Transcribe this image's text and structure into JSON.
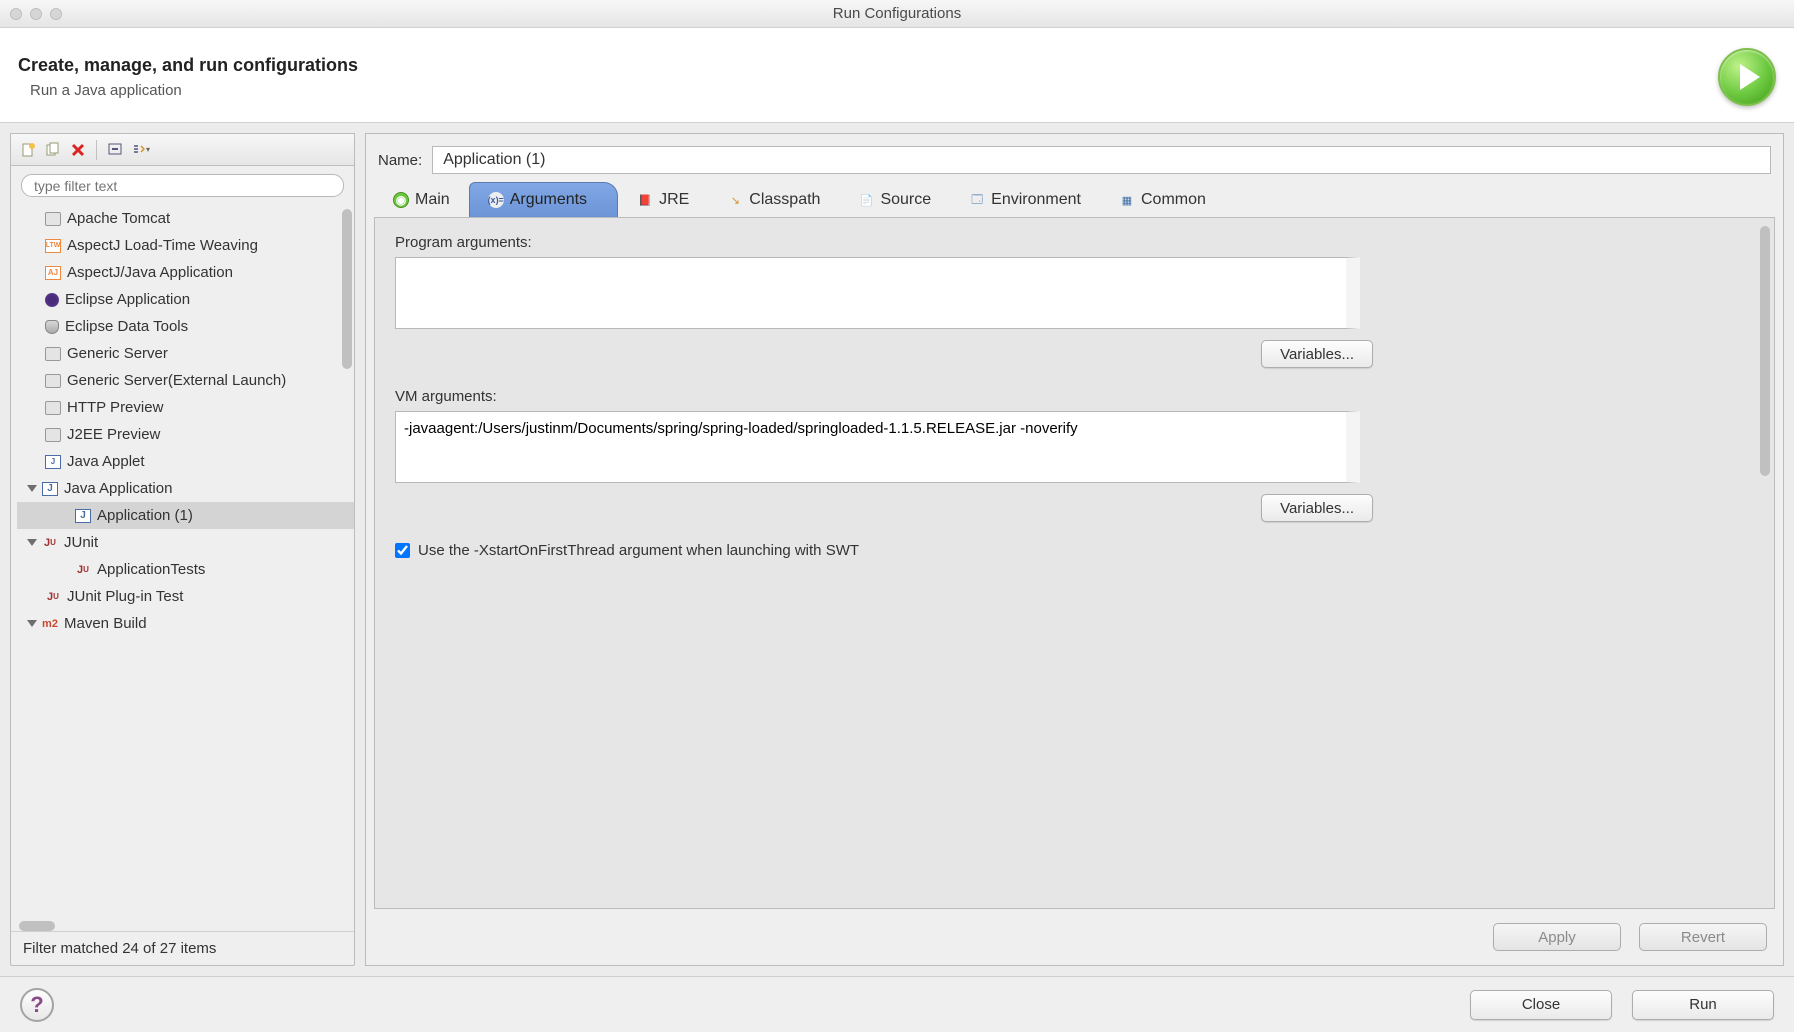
{
  "window": {
    "title": "Run Configurations"
  },
  "header": {
    "title": "Create, manage, and run configurations",
    "subtitle": "Run a Java application"
  },
  "sidebar": {
    "filter_placeholder": "type filter text",
    "items": [
      {
        "label": "Apache Tomcat",
        "icon": "server",
        "level": 1
      },
      {
        "label": "AspectJ Load-Time Weaving",
        "icon": "ltw",
        "level": 1
      },
      {
        "label": "AspectJ/Java Application",
        "icon": "aj",
        "level": 1
      },
      {
        "label": "Eclipse Application",
        "icon": "eclipse",
        "level": 1
      },
      {
        "label": "Eclipse Data Tools",
        "icon": "db",
        "level": 1
      },
      {
        "label": "Generic Server",
        "icon": "server",
        "level": 1
      },
      {
        "label": "Generic Server(External Launch)",
        "icon": "server",
        "level": 1
      },
      {
        "label": "HTTP Preview",
        "icon": "server",
        "level": 1
      },
      {
        "label": "J2EE Preview",
        "icon": "server",
        "level": 1
      },
      {
        "label": "Java Applet",
        "icon": "applet",
        "level": 1
      },
      {
        "label": "Java Application",
        "icon": "j",
        "level": 1,
        "expanded": true
      },
      {
        "label": "Application (1)",
        "icon": "j",
        "level": 2,
        "selected": true
      },
      {
        "label": "JUnit",
        "icon": "ju",
        "level": 1,
        "expanded": true
      },
      {
        "label": "ApplicationTests",
        "icon": "ju",
        "level": 2
      },
      {
        "label": "JUnit Plug-in Test",
        "icon": "ju",
        "level": 1
      },
      {
        "label": "Maven Build",
        "icon": "m2",
        "level": 1,
        "expanded": true
      }
    ],
    "filter_status": "Filter matched 24 of 27 items"
  },
  "name": {
    "label": "Name:",
    "value": "Application (1)"
  },
  "tabs": [
    {
      "label": "Main",
      "icon": "main"
    },
    {
      "label": "Arguments",
      "icon": "args",
      "active": true
    },
    {
      "label": "JRE",
      "icon": "jre"
    },
    {
      "label": "Classpath",
      "icon": "cp"
    },
    {
      "label": "Source",
      "icon": "src"
    },
    {
      "label": "Environment",
      "icon": "env"
    },
    {
      "label": "Common",
      "icon": "com"
    }
  ],
  "arguments": {
    "program_label": "Program arguments:",
    "program_value": "",
    "vm_label": "VM arguments:",
    "vm_value": "-javaagent:/Users/justinm/Documents/spring/spring-loaded/springloaded-1.1.5.RELEASE.jar -noverify",
    "variables_button": "Variables...",
    "swt_checkbox": "Use the -XstartOnFirstThread argument when launching with SWT",
    "swt_checked": true
  },
  "actions": {
    "apply": "Apply",
    "revert": "Revert"
  },
  "footer": {
    "close": "Close",
    "run": "Run"
  }
}
